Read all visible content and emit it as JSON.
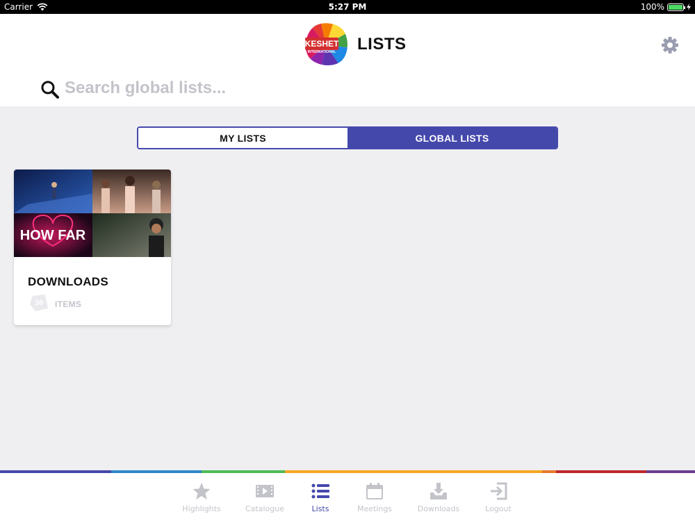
{
  "status_bar": {
    "carrier": "Carrier",
    "time": "5:27 PM",
    "battery_text": "100%",
    "battery_level": 1.0
  },
  "header": {
    "logo_text": "KESHET",
    "logo_subtext": "INTERNATIONAL",
    "title": "LISTS",
    "settings_icon": "gear-icon"
  },
  "search": {
    "placeholder": "Search global lists...",
    "value": ""
  },
  "segmented": {
    "my_lists": "MY LISTS",
    "global_lists": "GLOBAL LISTS",
    "selected": "GLOBAL LISTS"
  },
  "lists": [
    {
      "title": "DOWNLOADS",
      "count": "36",
      "count_label": "ITEMS",
      "thumb_overlay_text": "HOW FAR"
    }
  ],
  "tabs": [
    {
      "label": "Highlights",
      "icon": "star-icon"
    },
    {
      "label": "Catalogue",
      "icon": "film-icon"
    },
    {
      "label": "Lists",
      "icon": "list-icon"
    },
    {
      "label": "Meetings",
      "icon": "calendar-icon"
    },
    {
      "label": "Downloads",
      "icon": "download-icon"
    },
    {
      "label": "Logout",
      "icon": "logout-icon"
    }
  ],
  "active_tab": "Lists",
  "colors": {
    "accent": "#4548ab",
    "inactive": "#c3c4ca",
    "background": "#efeff2",
    "rainbow": [
      "#4548ab",
      "#2e86c9",
      "#4dbb57",
      "#f5a623",
      "#e8792d",
      "#c0282d",
      "#6a3d8c"
    ]
  }
}
